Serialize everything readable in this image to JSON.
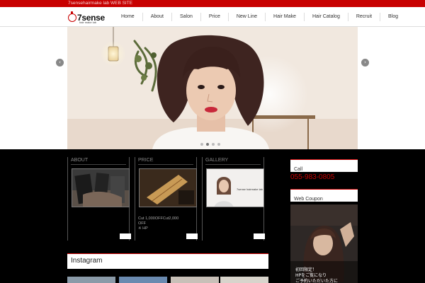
{
  "site": {
    "tagline": "7sensehairmake lab  WEB SITE"
  },
  "logo": {
    "name": "7sense",
    "sub": "hair make lab"
  },
  "nav": {
    "items": [
      {
        "label": "Home"
      },
      {
        "label": "About"
      },
      {
        "label": "Salon"
      },
      {
        "label": "Price"
      },
      {
        "label": "New Line"
      },
      {
        "label": "Hair Make"
      },
      {
        "label": "Hair Catalog"
      },
      {
        "label": "Recruit"
      },
      {
        "label": "Blog"
      }
    ]
  },
  "slider": {
    "prev": "‹",
    "next": "›",
    "dots": 4,
    "active_dot": 1
  },
  "panels": {
    "about": {
      "title": "ABOUT"
    },
    "price": {
      "title": "PRICE",
      "text_line1": "Cut 1,000OFFCut2,000",
      "text_line2": "OFF",
      "text_line3": "※ HP"
    },
    "gallery": {
      "title": "GALLERY",
      "caption": "7sense hairmake lab"
    }
  },
  "sidebar": {
    "call_label": "Call",
    "phone": "055-983-0805",
    "coupon_label": "Web Coupon",
    "coupon_line1": "初回限定！",
    "coupon_line2": "HPをご覧になり",
    "coupon_line3": "ご予約いただいた方に"
  },
  "instagram": {
    "title": "Instagram"
  },
  "colors": {
    "accent": "#c80000",
    "dark": "#000000",
    "phone": "#c80000"
  }
}
